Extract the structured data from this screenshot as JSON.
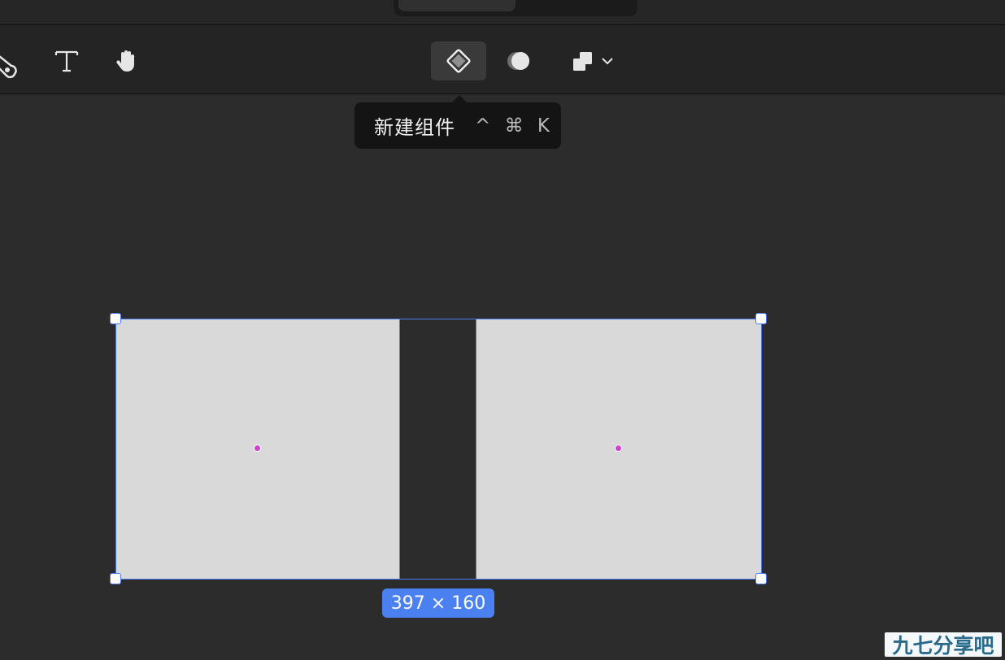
{
  "toolbar": {
    "tools": [
      {
        "name": "pen-tool",
        "icon": "pen-nib-icon"
      },
      {
        "name": "text-tool",
        "icon": "text-t-icon"
      },
      {
        "name": "hand-tool",
        "icon": "hand-icon"
      },
      {
        "name": "create-component",
        "icon": "component-diamond-icon",
        "active": true
      },
      {
        "name": "mask",
        "icon": "mask-half-circle-icon"
      },
      {
        "name": "boolean-group",
        "icon": "boolean-union-icon",
        "has_dropdown": true
      }
    ]
  },
  "tooltip": {
    "label": "新建组件",
    "shortcut": "^ ⌘ K"
  },
  "selection": {
    "size_label": "397 × 160"
  },
  "watermark": {
    "text": "九七分享吧"
  },
  "colors": {
    "canvas_bg": "#2c2c2c",
    "toolbar_bg": "#242424",
    "selection_blue": "#4a7bef",
    "badge_blue": "#4a80f0",
    "shape_fill": "#d9d9d9",
    "center_dot": "#d040d0"
  }
}
